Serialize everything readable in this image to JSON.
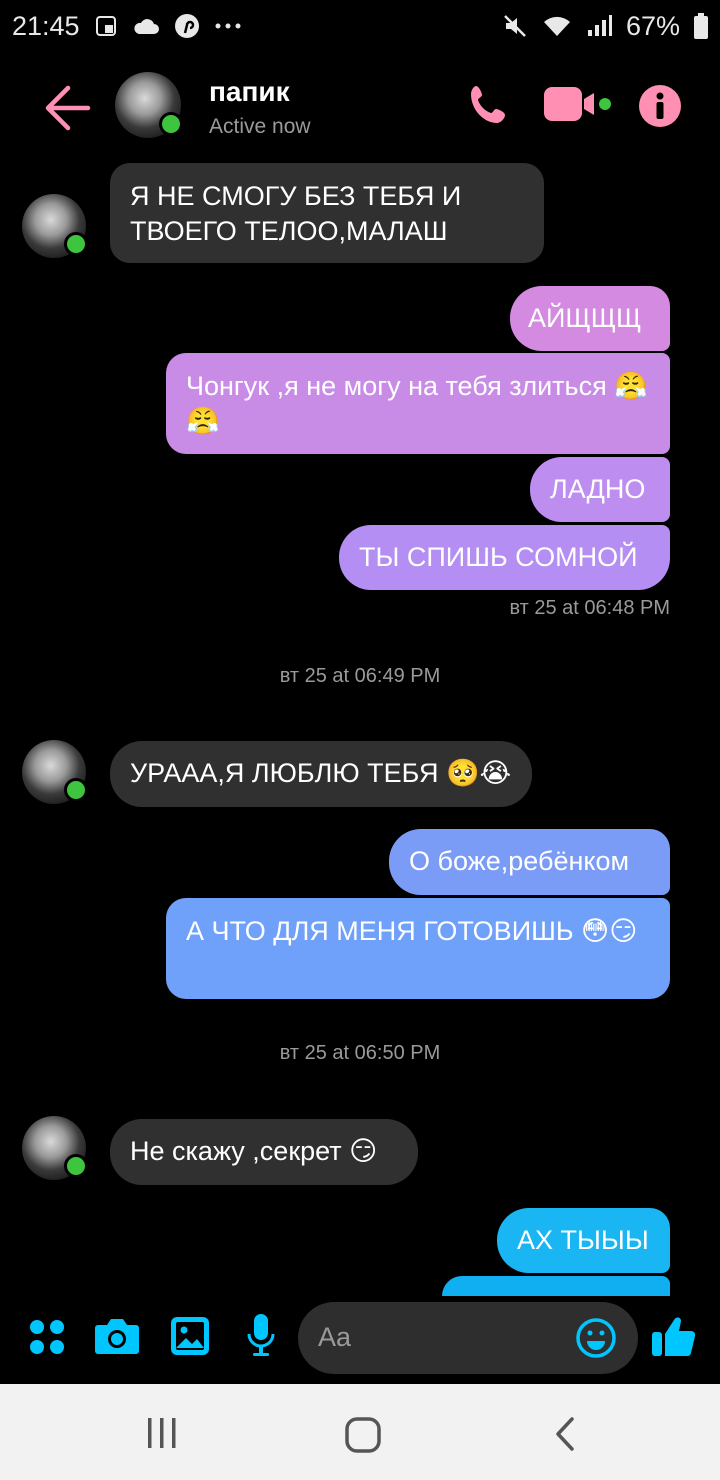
{
  "status_bar": {
    "time": "21:45",
    "icons_left": [
      "screenshot-icon",
      "cloud-icon",
      "pinterest-icon",
      "more-dots-icon"
    ],
    "icons_right": [
      "mute-icon",
      "wifi-icon",
      "signal-icon",
      "battery-icon"
    ],
    "battery": "67%"
  },
  "header": {
    "contact_name": "папик",
    "presence": "Active now",
    "accent_color": "#ff8fb3"
  },
  "messages": [
    {
      "side": "in",
      "text": "Я НЕ СМОГУ БЕЗ ТЕБЯ И ТВОЕГО ТЕЛОО,МАЛАШ"
    },
    {
      "side": "out",
      "text": "АЙЩЩЩ"
    },
    {
      "side": "out",
      "text": "Чонгук ,я не могу на тебя злиться 😤😤"
    },
    {
      "side": "out",
      "text": "ЛАДНО"
    },
    {
      "side": "out",
      "text": "ТЫ СПИШЬ СОМНОЙ"
    },
    {
      "side": "in",
      "text": "УРААА,Я ЛЮБЛЮ ТЕБЯ 🥺😭"
    },
    {
      "side": "out",
      "text": "О боже,ребёнком"
    },
    {
      "side": "out",
      "text": "А ЧТО ДЛЯ МЕНЯ ГОТОВИШЬ 😳😏"
    },
    {
      "side": "in",
      "text": "Не скажу ,секрет 😏"
    },
    {
      "side": "out",
      "text": "АХ ТЫЫЫ"
    }
  ],
  "timestamps": [
    "вт 25 at 06:48 PM",
    "вт 25 at 06:49 PM",
    "вт 25 at 06:50 PM"
  ],
  "composer": {
    "placeholder": "Aa",
    "accent_color": "#00c6ff"
  },
  "colors": {
    "out_bubble_pink": "#d58be0",
    "out_bubble_purple": "#b38cf2",
    "out_bubble_blue": "#6f9cf8",
    "out_bubble_cyan": "#1ab3f4",
    "in_bubble": "#303030"
  }
}
